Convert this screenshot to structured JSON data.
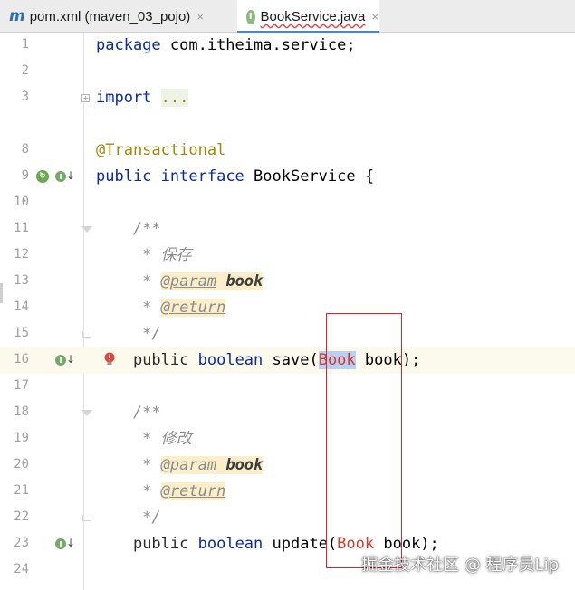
{
  "tabs": [
    {
      "icon": "maven-icon",
      "label": "pom.xml (maven_03_pojo)",
      "close": "×"
    },
    {
      "icon": "interface-icon",
      "label": "BookService.java",
      "close": "×",
      "active": true
    }
  ],
  "lines": {
    "l1": {
      "n": "1",
      "kw": "package",
      "rest": " com.itheima.service;"
    },
    "l2": {
      "n": "2"
    },
    "l3": {
      "n": "3",
      "kw": "import",
      "dots": "..."
    },
    "l8": {
      "n": "8",
      "ann": "@Transactional"
    },
    "l9": {
      "n": "9",
      "kw1": "public",
      "kw2": "interface",
      "rest": " BookService {"
    },
    "l10": {
      "n": "10"
    },
    "l11": {
      "n": "11",
      "text": "    /**"
    },
    "l12": {
      "n": "12",
      "text": "     * 保存"
    },
    "l13": {
      "n": "13",
      "star": "     * ",
      "tag": "@param",
      "ref": "book"
    },
    "l14": {
      "n": "14",
      "star": "     * ",
      "tag": "@return"
    },
    "l15": {
      "n": "15",
      "text": "     */"
    },
    "l16": {
      "n": "16",
      "indent": "    ",
      "kw1": "public",
      "kw2": "boolean",
      "method": " save(",
      "type": "Book",
      "rest": " book);"
    },
    "l17": {
      "n": "17"
    },
    "l18": {
      "n": "18",
      "text": "    /**"
    },
    "l19": {
      "n": "19",
      "text": "     * 修改"
    },
    "l20": {
      "n": "20",
      "star": "     * ",
      "tag": "@param",
      "ref": "book"
    },
    "l21": {
      "n": "21",
      "star": "     * ",
      "tag": "@return"
    },
    "l22": {
      "n": "22",
      "text": "     */"
    },
    "l23": {
      "n": "23",
      "indent": "    ",
      "kw1": "public",
      "kw2": "boolean",
      "method": " update(",
      "type": "Book",
      "rest": " book);"
    },
    "l24": {
      "n": "24"
    }
  },
  "gutter_icons": {
    "spring": "spring-bean-icon",
    "impl": "implemented-icon",
    "arrow": "↓",
    "impl_letter": "I",
    "spring_letter": "↻",
    "bulb": "error-bulb-icon"
  },
  "watermark": "掘金技术社区 @ 程序员Lip",
  "colors": {
    "keyword": "#0b2a9e",
    "annotation": "#9e880d",
    "error": "#d33a2c",
    "highlight_box": "#d1282e",
    "current_line": "#fcfaed"
  }
}
